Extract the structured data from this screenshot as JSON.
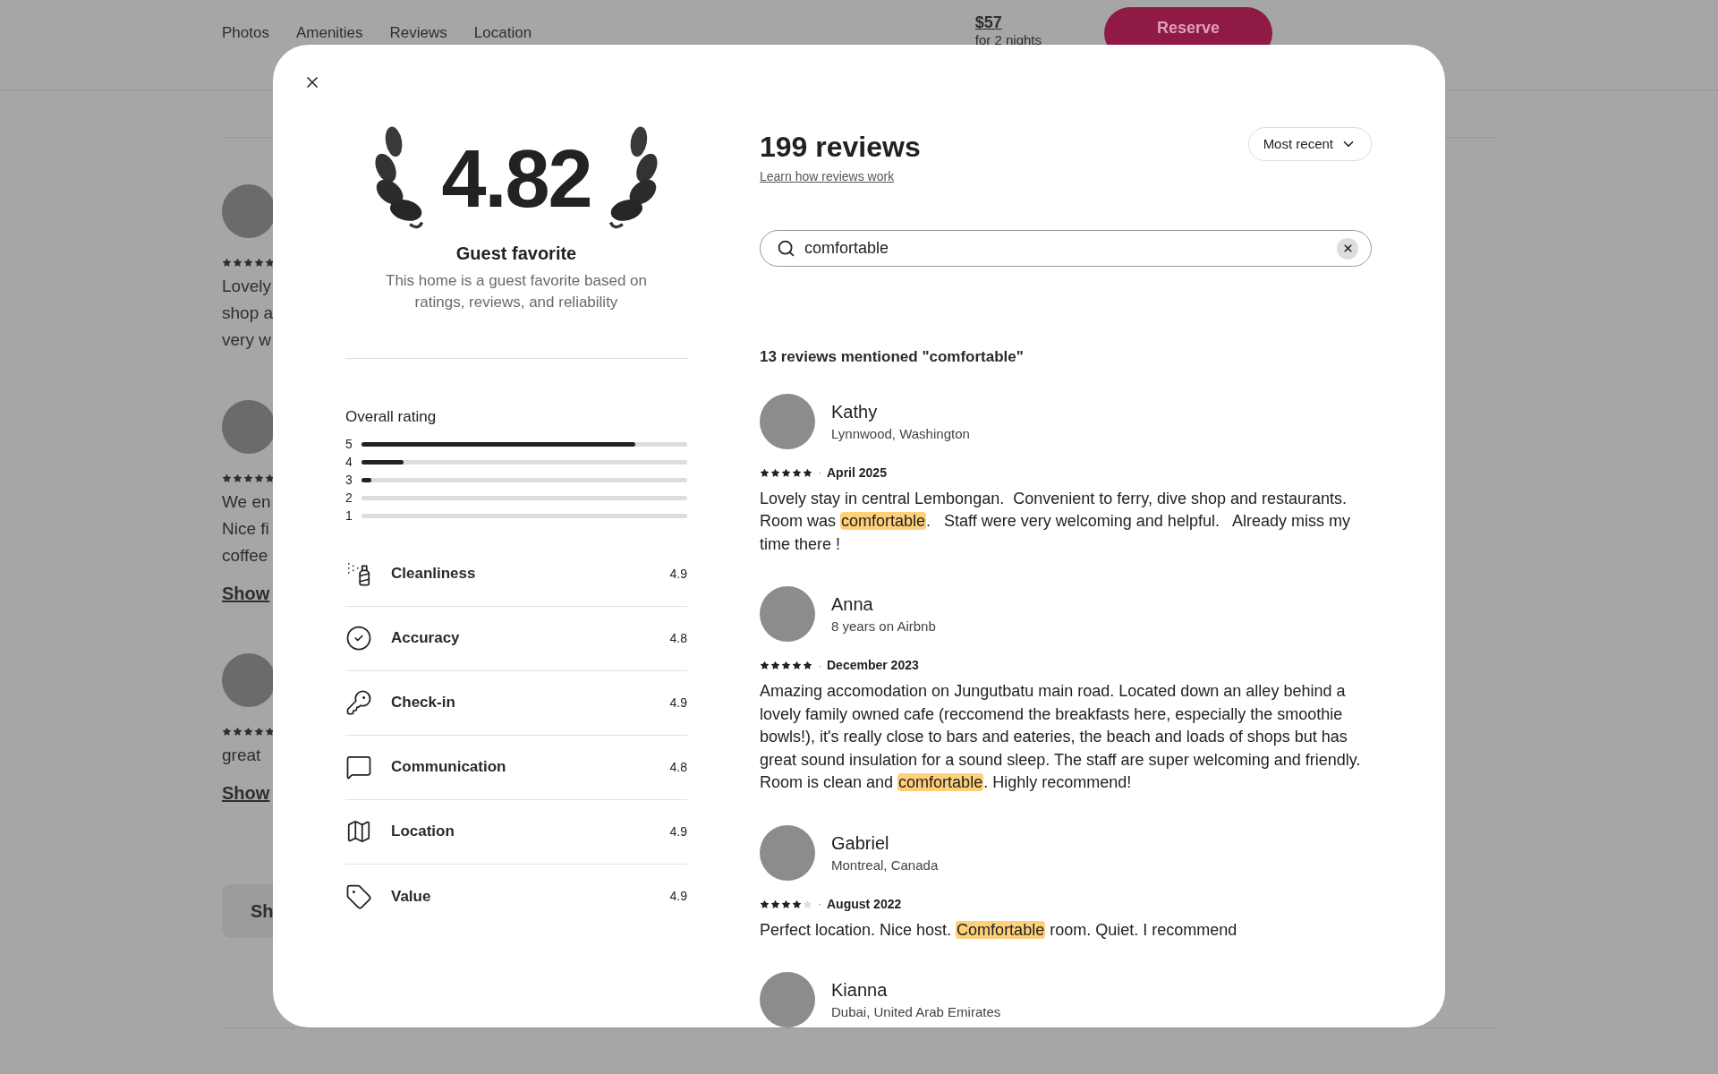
{
  "background": {
    "nav": [
      "Photos",
      "Amenities",
      "Reviews",
      "Location"
    ],
    "price": "$57",
    "price_note": "for 2 nights",
    "reserve": "Reserve",
    "reviews": [
      {
        "stars": 5,
        "lines": [
          "Lovely",
          "shop a",
          "very w"
        ]
      },
      {
        "stars": 5,
        "lines": [
          "We en",
          "Nice fi",
          "coffee"
        ],
        "link": "Show"
      },
      {
        "stars": 5,
        "lines": [
          "great"
        ],
        "link": "Show"
      }
    ],
    "show_all": "Sh"
  },
  "modal": {
    "rating": "4.82",
    "badge_title": "Guest favorite",
    "badge_text": "This home is a guest favorite based on ratings, reviews, and reliability",
    "overall_title": "Overall rating",
    "distribution": [
      {
        "label": "5",
        "level": 0.84
      },
      {
        "label": "4",
        "level": 0.13
      },
      {
        "label": "3",
        "level": 0.03
      },
      {
        "label": "2",
        "level": 0
      },
      {
        "label": "1",
        "level": 0
      }
    ],
    "categories": [
      {
        "kind": "spray",
        "label": "Cleanliness",
        "value": "4.9"
      },
      {
        "kind": "check",
        "label": "Accuracy",
        "value": "4.8"
      },
      {
        "kind": "key",
        "label": "Check-in",
        "value": "4.9"
      },
      {
        "kind": "chat",
        "label": "Communication",
        "value": "4.8"
      },
      {
        "kind": "map",
        "label": "Location",
        "value": "4.9"
      },
      {
        "kind": "tag",
        "label": "Value",
        "value": "4.9"
      }
    ],
    "title": "199 reviews",
    "learn_link": "Learn how reviews work",
    "sort": "Most recent",
    "search": {
      "value": "comfortable"
    },
    "results_text": "13 reviews mentioned \"comfortable\"",
    "reviews": [
      {
        "name": "Kathy",
        "sub": "Lynnwood, Washington",
        "stars": 5,
        "separator": "·",
        "date": "April 2025",
        "text": [
          {
            "t": "Lovely stay in central Lembongan.  Convenient to ferry, dive shop and restaurants. Room was ",
            "highlight": false
          },
          {
            "t": "comfortable",
            "highlight": true
          },
          {
            "t": ".   Staff were very welcoming and helpful.   Already miss my time there !",
            "highlight": false
          }
        ]
      },
      {
        "name": "Anna",
        "sub": "8 years on Airbnb",
        "stars": 5,
        "separator": "·",
        "date": "December 2023",
        "text": [
          {
            "t": "Amazing accomodation on Jungutbatu main road. Located down an alley behind a lovely family owned cafe (reccomend the breakfasts here, especially the smoothie bowls!), it's really close to bars and eateries, the beach and loads of shops but has great sound insulation for a sound sleep. The staff are super welcoming and friendly. Room is clean and ",
            "highlight": false
          },
          {
            "t": "comfortable",
            "highlight": true
          },
          {
            "t": ". Highly recommend!",
            "highlight": false
          }
        ]
      },
      {
        "name": "Gabriel",
        "sub": "Montreal, Canada",
        "stars": 4,
        "separator": "·",
        "date": "August 2022",
        "text": [
          {
            "t": "Perfect location. Nice host. ",
            "highlight": false
          },
          {
            "t": "Comfortable",
            "highlight": true
          },
          {
            "t": " room. Quiet. I recommend",
            "highlight": false
          }
        ]
      },
      {
        "name": "Kianna",
        "sub": "Dubai, United Arab Emirates"
      }
    ]
  }
}
